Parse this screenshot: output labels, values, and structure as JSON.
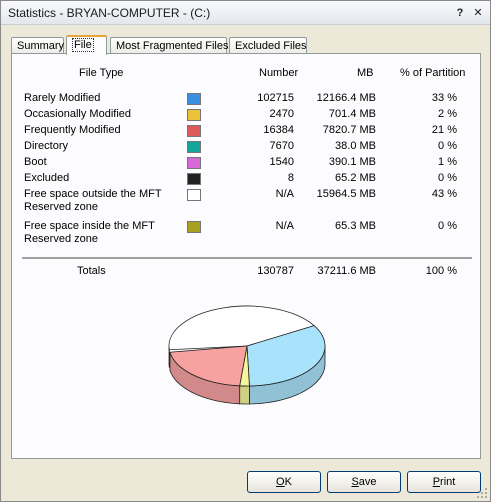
{
  "window": {
    "title": "Statistics - BRYAN-COMPUTER - (C:)",
    "help_label": "?",
    "close_label": "✕"
  },
  "tabs": [
    {
      "label": "Summary"
    },
    {
      "label": "File"
    },
    {
      "label": "Most Fragmented Files"
    },
    {
      "label": "Excluded Files"
    }
  ],
  "active_tab": "File",
  "table": {
    "headers": {
      "type": "File Type",
      "number": "Number",
      "mb": "MB",
      "pct": "% of Partition"
    },
    "rows": [
      {
        "type": "Rarely Modified",
        "color": "#3b8fe0",
        "number": "102715",
        "mb": "12166.4 MB",
        "pct": "33 %"
      },
      {
        "type": "Occasionally Modified",
        "color": "#ecc23a",
        "number": "2470",
        "mb": "701.4 MB",
        "pct": "2 %"
      },
      {
        "type": "Frequently Modified",
        "color": "#de5a5a",
        "number": "16384",
        "mb": "7820.7 MB",
        "pct": "21 %"
      },
      {
        "type": "Directory",
        "color": "#13a59a",
        "number": "7670",
        "mb": "38.0 MB",
        "pct": "0 %"
      },
      {
        "type": "Boot",
        "color": "#d867d8",
        "number": "1540",
        "mb": "390.1 MB",
        "pct": "1 %"
      },
      {
        "type": "Excluded",
        "color": "#222222",
        "number": "8",
        "mb": "65.2 MB",
        "pct": "0 %"
      },
      {
        "type": "Free space outside the MFT Reserved zone",
        "color": "#ffffff",
        "number": "N/A",
        "mb": "15964.5 MB",
        "pct": "43 %"
      },
      {
        "type": "Free space inside the MFT Reserved zone",
        "color": "#a8a020",
        "number": "N/A",
        "mb": "65.3 MB",
        "pct": "0 %"
      }
    ],
    "totals": {
      "label": "Totals",
      "number": "130787",
      "mb": "37211.6 MB",
      "pct": "100 %"
    }
  },
  "chart_data": {
    "type": "pie",
    "categories": [
      "Rarely Modified",
      "Occasionally Modified",
      "Frequently Modified",
      "Directory",
      "Boot",
      "Excluded",
      "Free space outside the MFT Reserved zone",
      "Free space inside the MFT Reserved zone"
    ],
    "values": [
      33,
      2,
      21,
      0,
      1,
      0,
      43,
      0
    ],
    "colors": [
      "#a9e3fb",
      "#f5f59a",
      "#f7a1a1",
      "#6fd1c6",
      "#e8a0e8",
      "#444444",
      "#ffffff",
      "#c9c470"
    ]
  },
  "buttons": {
    "ok": {
      "label": "OK",
      "underline": "O",
      "rest": "K"
    },
    "save": {
      "label": "Save",
      "underline": "S",
      "rest": "ave"
    },
    "print": {
      "label": "Print",
      "underline": "P",
      "rest": "rint"
    }
  }
}
